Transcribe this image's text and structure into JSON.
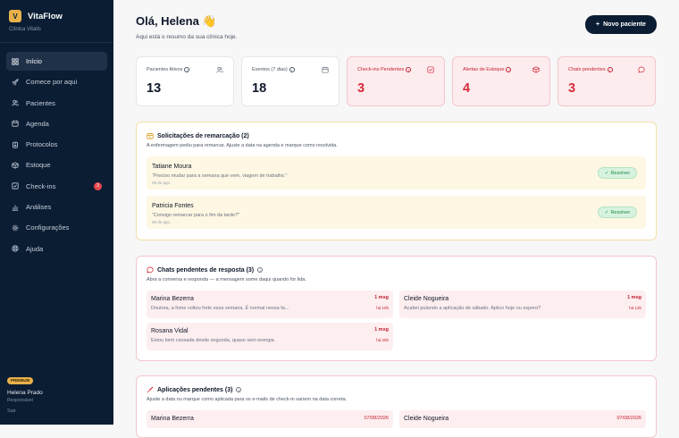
{
  "sidebar": {
    "logo_letter": "V",
    "brand_name": "VitaFlow",
    "clinic": "Clínica Vitalis",
    "items": [
      {
        "label": "Início",
        "icon": "grid-icon",
        "active": true
      },
      {
        "label": "Comece por aqui",
        "icon": "rocket-icon"
      },
      {
        "label": "Pacientes",
        "icon": "users-icon"
      },
      {
        "label": "Agenda",
        "icon": "calendar-icon"
      },
      {
        "label": "Protocolos",
        "icon": "clipboard-icon"
      },
      {
        "label": "Estoque",
        "icon": "box-icon"
      },
      {
        "label": "Check-ins",
        "icon": "check-square-icon",
        "badge": "3"
      },
      {
        "label": "Análises",
        "icon": "bar-chart-icon"
      },
      {
        "label": "Configurações",
        "icon": "gear-icon"
      },
      {
        "label": "Ajuda",
        "icon": "help-icon"
      }
    ],
    "plan": "PREMIUM",
    "user_name": "Helena Prado",
    "user_role": "Responsável",
    "logout": "Sair"
  },
  "header": {
    "greeting": "Olá, Helena 👋",
    "subtitle": "Aqui está o resumo da sua clínica hoje.",
    "new_patient": "Novo paciente"
  },
  "stats": [
    {
      "label": "Pacientes Ativos",
      "value": "13",
      "icon": "users-icon",
      "alert": false
    },
    {
      "label": "Eventos (7 dias)",
      "value": "18",
      "icon": "calendar-icon",
      "alert": false
    },
    {
      "label": "Check-ins Pendentes",
      "value": "3",
      "icon": "check-square-icon",
      "alert": true
    },
    {
      "label": "Alertas de Estoque",
      "value": "4",
      "icon": "box-icon",
      "alert": true
    },
    {
      "label": "Chats pendentes",
      "value": "3",
      "icon": "chat-icon",
      "alert": true
    }
  ],
  "reschedule": {
    "title": "Solicitações de remarcação (2)",
    "subtitle": "A enfermagem pediu para remarcar. Ajuste a data na agenda e marque como resolvida.",
    "resolve_label": "Resolver",
    "items": [
      {
        "name": "Tatiane Moura",
        "quote": "“Preciso mudar para a semana que vem, viagem de trabalho.”",
        "date": "08 de ago."
      },
      {
        "name": "Patricia Fontes",
        "quote": "“Consigo remarcar para o fim da tarde?”",
        "date": "08 de ago."
      }
    ]
  },
  "chats": {
    "title": "Chats pendentes de resposta (3)",
    "subtitle": "Abra a conversa e responda — a mensagem some daqui quando for lida.",
    "items": [
      {
        "name": "Marina Bezerra",
        "message": "Doutora, a fome voltou forte essa semana. É normal nessa fa...",
        "count": "1 msg",
        "time": "há 10h"
      },
      {
        "name": "Cleide Nogueira",
        "message": "Acabei pulando a aplicação de sábado. Aplico hoje ou espero?",
        "count": "1 msg",
        "time": "há 13h"
      },
      {
        "name": "Rosana Vidal",
        "message": "Estou bem cansada desde segunda, quase sem energia.",
        "count": "1 msg",
        "time": "há 20h"
      }
    ]
  },
  "applications": {
    "title": "Aplicações pendentes (3)",
    "subtitle": "Ajuste a data ou marque como aplicada para os e-mails de check-in saírem na data correta.",
    "items": [
      {
        "name": "Marina Bezerra",
        "date": "07/08/2026"
      },
      {
        "name": "Cleide Nogueira",
        "date": "07/08/2026"
      }
    ]
  },
  "colors": {
    "sidebar_bg": "#0b1d33",
    "accent": "#e8b04a",
    "alert_red": "#d62b3b",
    "success_green": "#1f8a48"
  }
}
